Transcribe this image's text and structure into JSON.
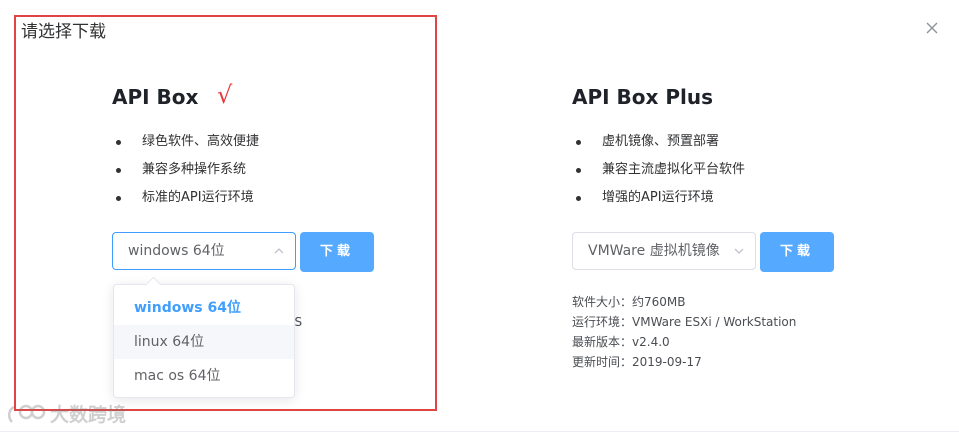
{
  "dialog": {
    "title": "请选择下载"
  },
  "products": [
    {
      "name": "API Box",
      "mark": "√",
      "features": [
        "绿色软件、高效便捷",
        "兼容多种操作系统",
        "标准的API运行环境"
      ],
      "select_value": "windows 64位",
      "download_label": "下载",
      "partial_info": "OS"
    },
    {
      "name": "API Box Plus",
      "features": [
        "虚机镜像、预置部署",
        "兼容主流虚拟化平台软件",
        "增强的API运行环境"
      ],
      "select_value": "VMWare 虚拟机镜像",
      "download_label": "下载",
      "info": [
        {
          "label": "软件大小：",
          "value": "约760MB"
        },
        {
          "label": "运行环境：",
          "value": "VMWare ESXi / WorkStation"
        },
        {
          "label": "最新版本：",
          "value": "v2.4.0"
        },
        {
          "label": "更新时间：",
          "value": "2019-09-17"
        }
      ]
    }
  ],
  "dropdown": {
    "options": [
      "windows 64位",
      "linux 64位",
      "mac os 64位"
    ],
    "selected_index": 0,
    "hover_index": 1
  },
  "colors": {
    "accent": "#409eff",
    "button": "#55a9ff",
    "highlight": "#e04545",
    "checkmark": "#e33b3b"
  },
  "watermark": {
    "text": "大数跨境"
  }
}
